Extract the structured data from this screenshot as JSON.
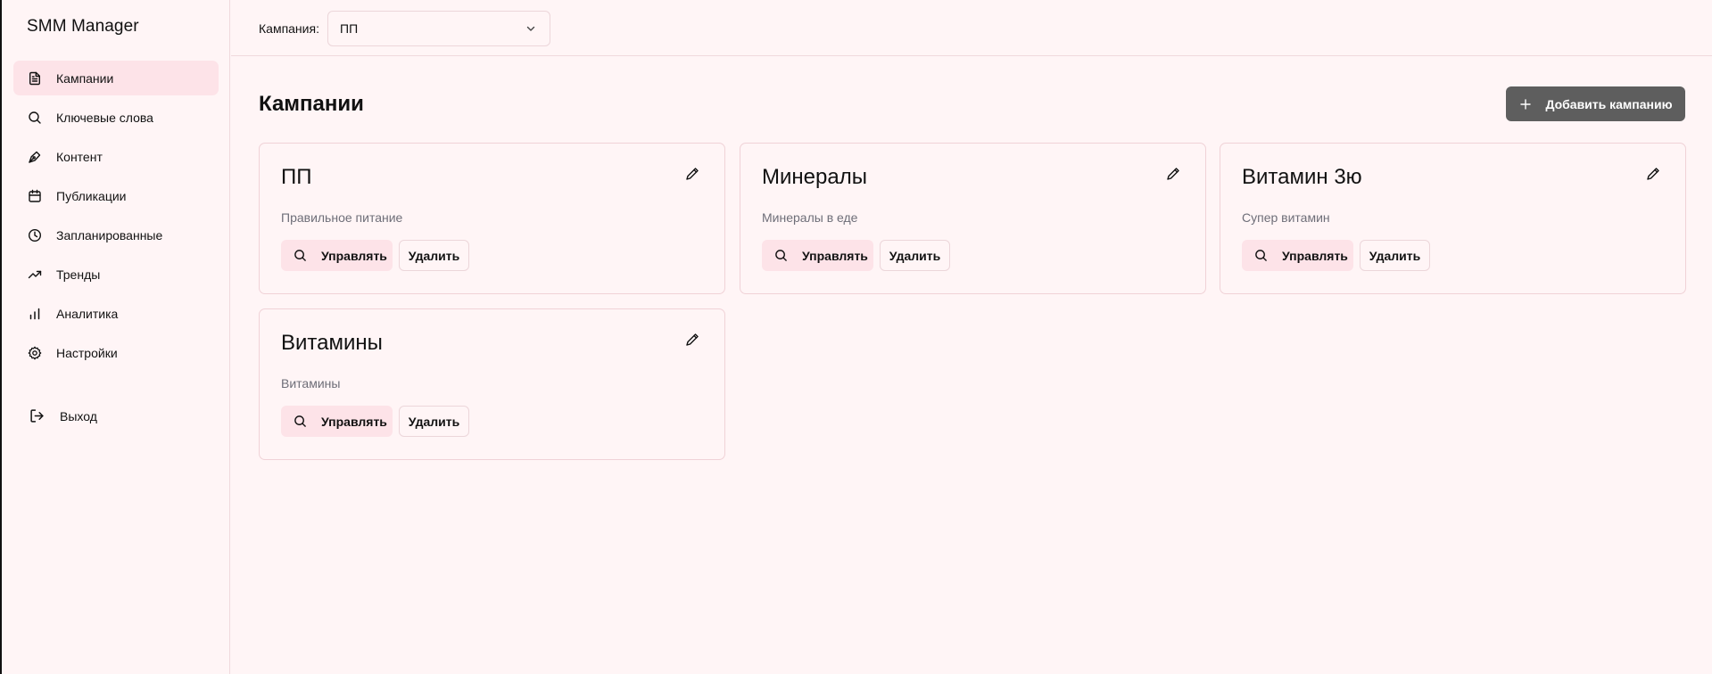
{
  "app": {
    "title": "SMM Manager"
  },
  "sidebar": {
    "items": [
      {
        "label": "Кампании",
        "icon": "document-icon",
        "active": true
      },
      {
        "label": "Ключевые слова",
        "icon": "search-icon",
        "active": false
      },
      {
        "label": "Контент",
        "icon": "pen-nib-icon",
        "active": false
      },
      {
        "label": "Публикации",
        "icon": "calendar-icon",
        "active": false
      },
      {
        "label": "Запланированные",
        "icon": "clock-icon",
        "active": false
      },
      {
        "label": "Тренды",
        "icon": "trending-up-icon",
        "active": false
      },
      {
        "label": "Аналитика",
        "icon": "bar-chart-icon",
        "active": false
      },
      {
        "label": "Настройки",
        "icon": "gear-icon",
        "active": false
      }
    ],
    "logout": {
      "label": "Выход",
      "icon": "logout-icon"
    }
  },
  "topbar": {
    "campaign_label": "Кампания:",
    "campaign_selected": "ПП"
  },
  "main": {
    "title": "Кампании",
    "add_button": "Добавить кампанию",
    "cards": [
      {
        "title": "ПП",
        "description": "Правильное питание",
        "manage": "Управлять",
        "delete": "Удалить"
      },
      {
        "title": "Минералы",
        "description": "Минералы в еде",
        "manage": "Управлять",
        "delete": "Удалить"
      },
      {
        "title": "Витамин 3ю",
        "description": "Супер витамин",
        "manage": "Управлять",
        "delete": "Удалить"
      },
      {
        "title": "Витамины",
        "description": "Витамины",
        "manage": "Управлять",
        "delete": "Удалить"
      }
    ]
  },
  "colors": {
    "background": "#fff5f6",
    "active_nav": "#fde3e8",
    "primary_button": "#5e5e5e",
    "border": "#f0d2d7",
    "muted_text": "#6e6e78"
  }
}
